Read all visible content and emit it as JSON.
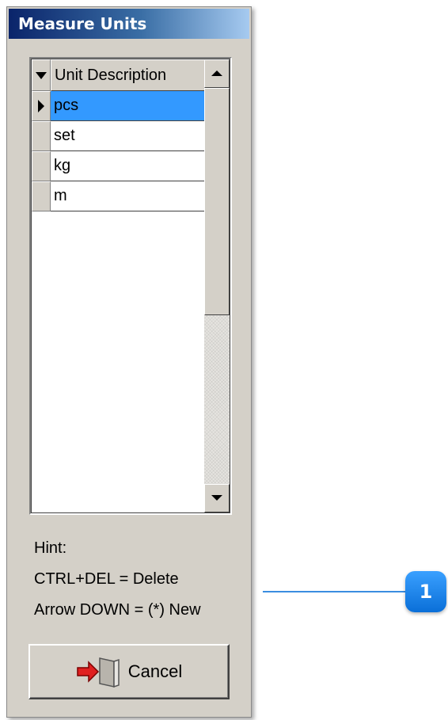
{
  "window": {
    "title": "Measure Units"
  },
  "grid": {
    "column_header": "Unit Description",
    "rows": [
      {
        "label": "pcs",
        "selected": true
      },
      {
        "label": "set",
        "selected": false
      },
      {
        "label": "kg",
        "selected": false
      },
      {
        "label": "m",
        "selected": false
      }
    ]
  },
  "hint": {
    "title": "Hint:",
    "line1": "CTRL+DEL = Delete",
    "line2": "Arrow DOWN = (*) New"
  },
  "buttons": {
    "cancel_label": "Cancel"
  },
  "callout": {
    "number": "1"
  },
  "colors": {
    "selection": "#3399ff",
    "callout": "#1a7fe8",
    "title_start": "#0a246a",
    "title_end": "#a6caf0"
  }
}
